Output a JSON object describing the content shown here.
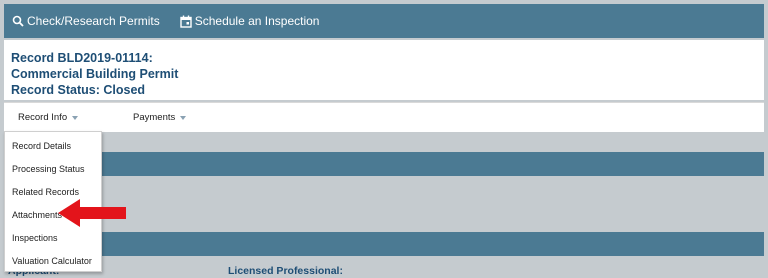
{
  "topnav": {
    "check_research": "Check/Research Permits",
    "schedule": "Schedule an Inspection"
  },
  "record": {
    "number": "Record BLD2019-01114:",
    "type": "Commercial Building Permit",
    "status": "Record Status: Closed"
  },
  "tabs": [
    {
      "label": "Record Info"
    },
    {
      "label": "Payments"
    }
  ],
  "dropdown": {
    "items": [
      {
        "label": "Record Details"
      },
      {
        "label": "Processing Status"
      },
      {
        "label": "Related Records"
      },
      {
        "label": "Attachments"
      },
      {
        "label": "Inspections"
      },
      {
        "label": "Valuation Calculator"
      }
    ]
  },
  "content": {
    "applicant_label": "Applicant:",
    "licensed_professional_label": "Licensed Professional:"
  },
  "colors": {
    "nav_bar": "#4b7a93",
    "record_text": "#1e4e75",
    "arrow": "#e3141b"
  }
}
